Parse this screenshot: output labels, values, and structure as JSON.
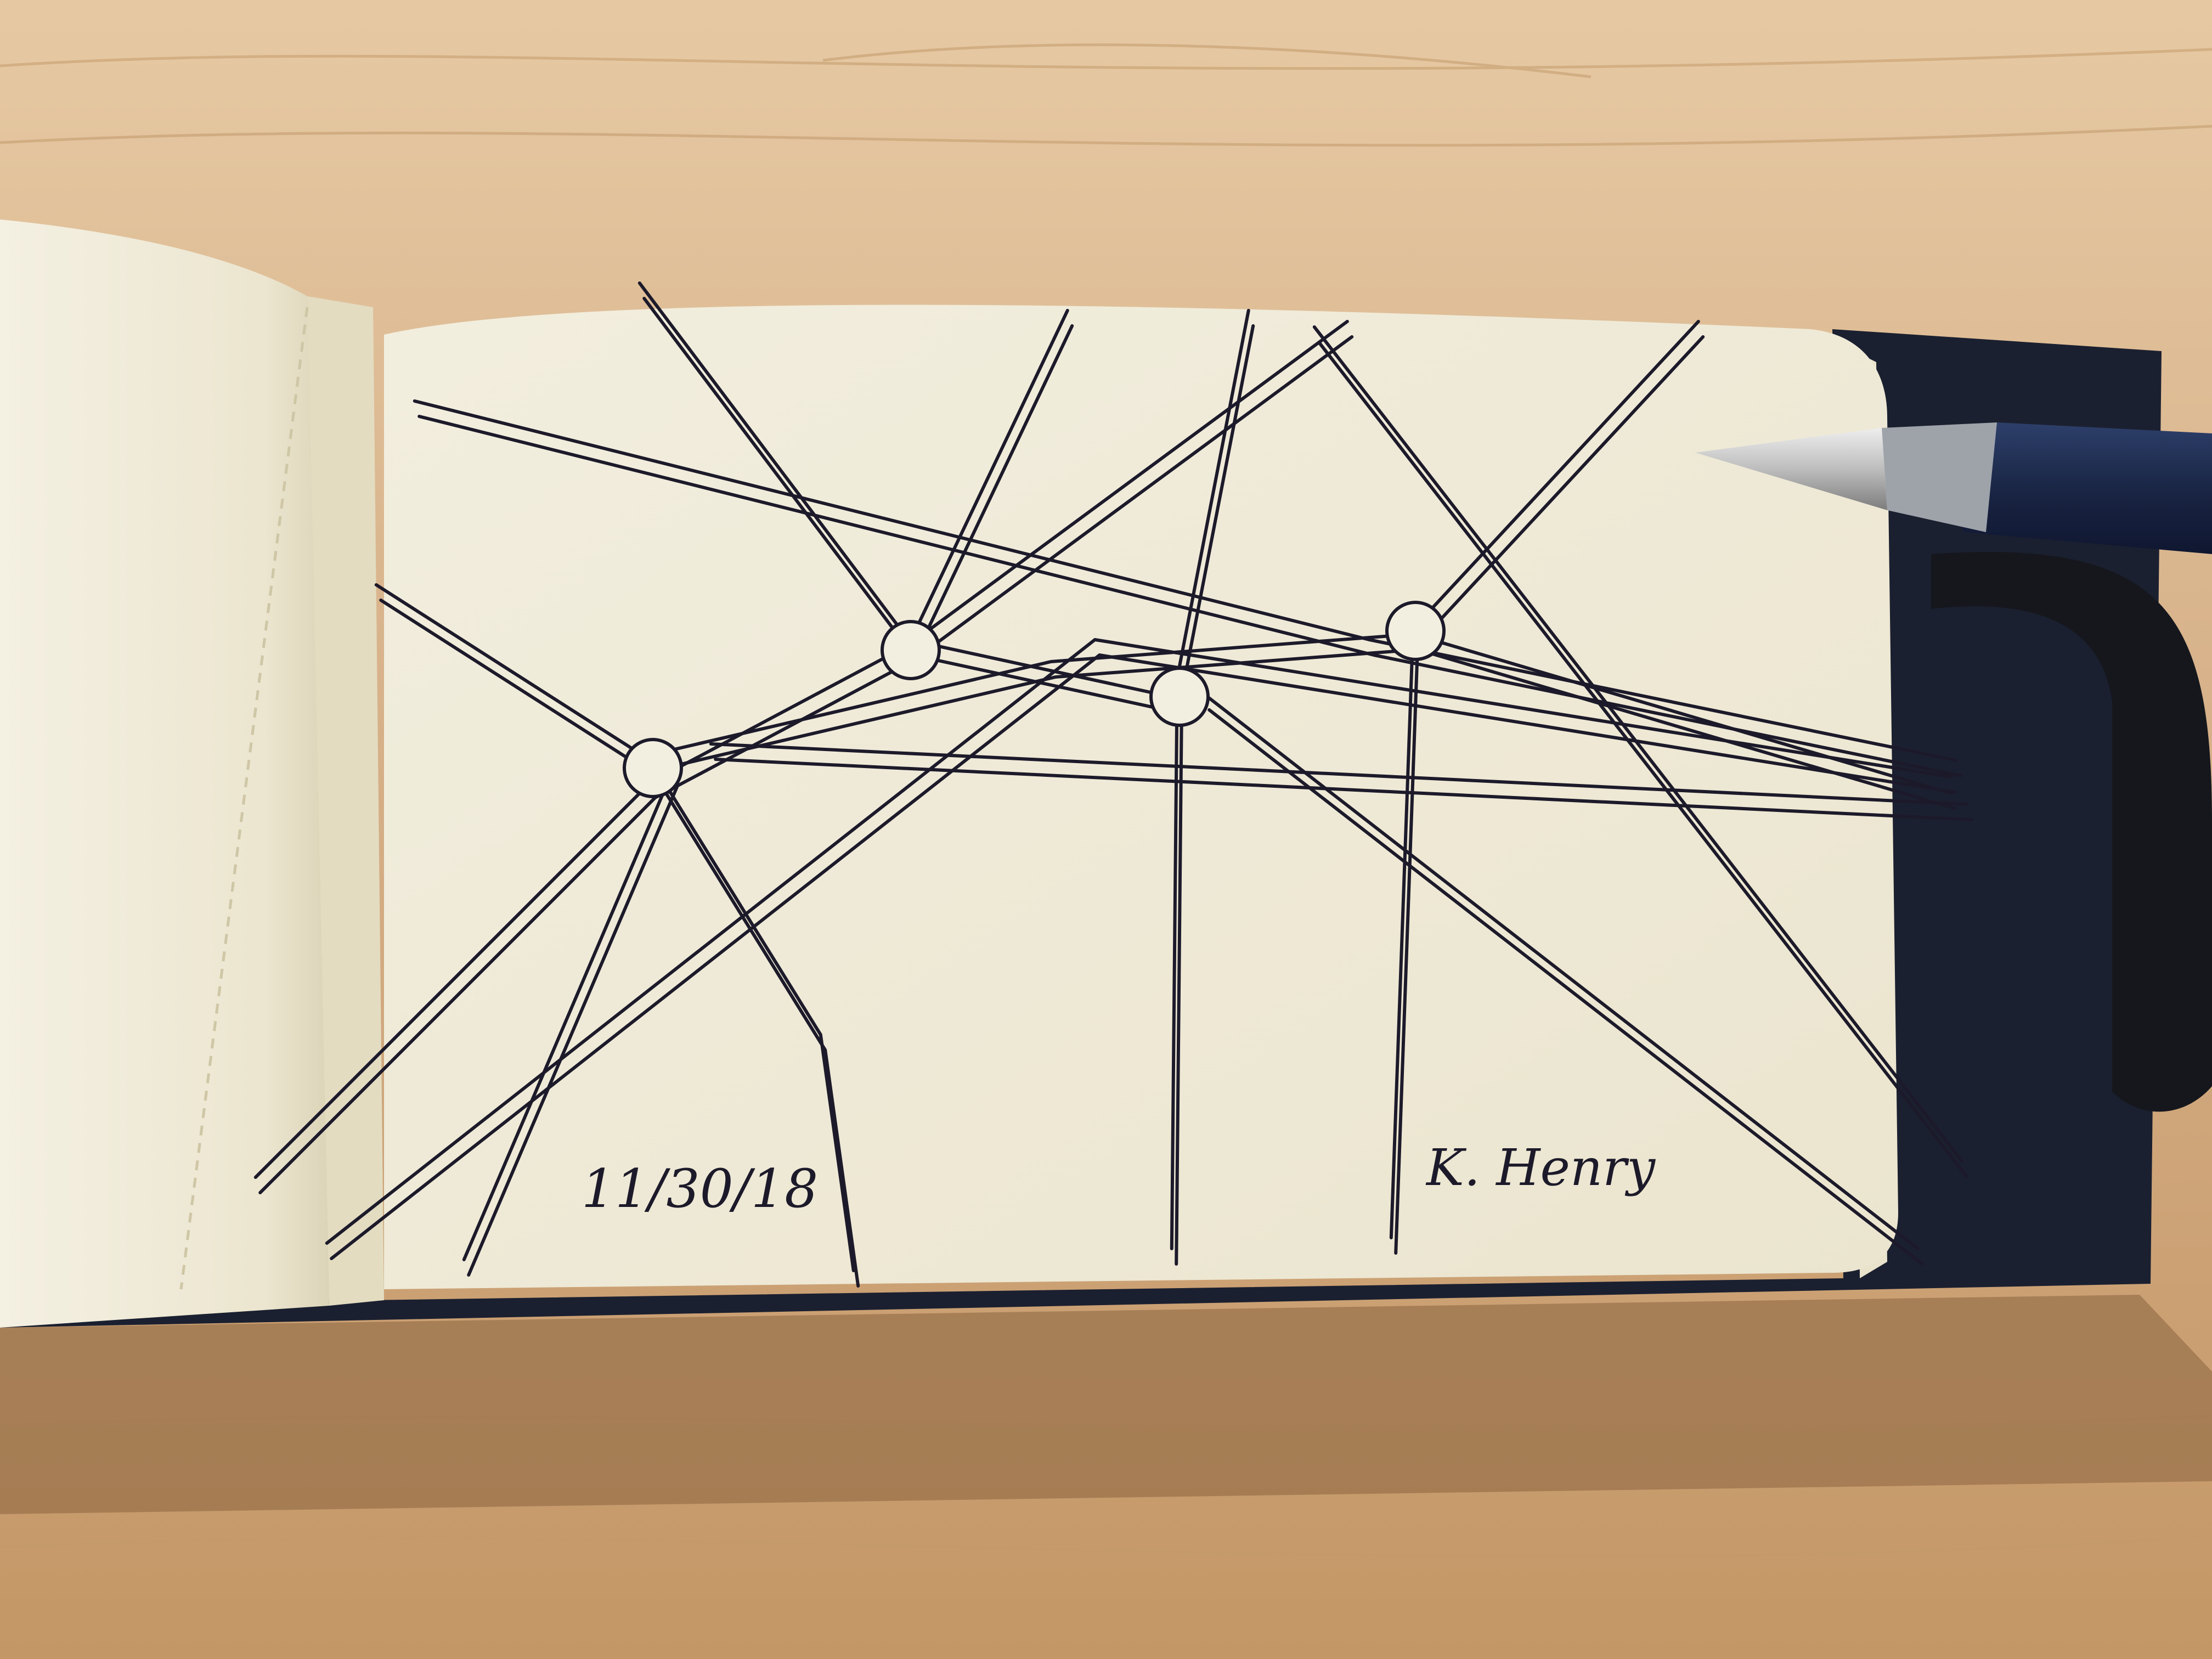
{
  "photo": {
    "subject": "ink drawing in an open sketchbook with a pen",
    "colors": {
      "table": "#d8b58f",
      "table_dark": "#b98a5c",
      "paper": "#f3efe0",
      "paper_shadow": "#e2dcc6",
      "ink": "#1c1a2a",
      "cover": "#1b2030",
      "pen_barrel": "#1d2a4a",
      "pen_tip": "#c9c9c9",
      "elastic_band": "#15171d"
    }
  },
  "drawing": {
    "date": "11/30/18",
    "signature": "K. Henry"
  }
}
